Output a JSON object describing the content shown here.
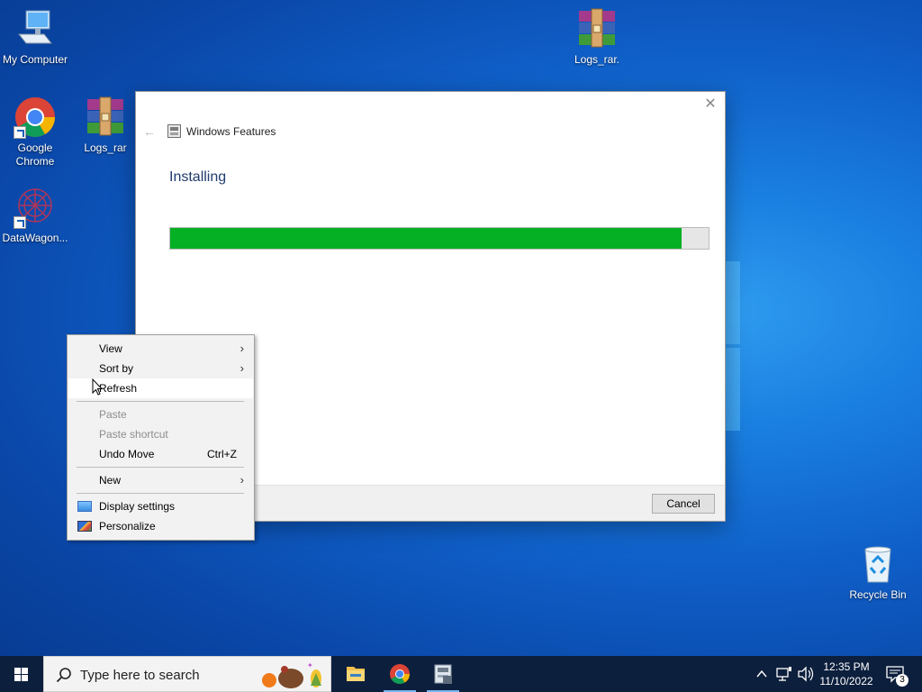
{
  "desktop": {
    "icons": [
      {
        "label": "My Computer",
        "icon": "computer-icon"
      },
      {
        "label": "Logs_rar.",
        "icon": "winrar-archive-icon"
      },
      {
        "label": "Google Chrome",
        "icon": "chrome-icon"
      },
      {
        "label": "Logs_rar",
        "icon": "winrar-archive-icon"
      },
      {
        "label": "DataWagon...",
        "icon": "datawagon-icon"
      },
      {
        "label": "Recycle Bin",
        "icon": "recycle-bin-icon"
      }
    ]
  },
  "dialog": {
    "title": "Windows Features",
    "heading": "Installing",
    "progress": 0.95,
    "progress_color": "#06b025",
    "cancel_label": "Cancel",
    "close_glyph": "✕",
    "back_glyph": "←"
  },
  "context_menu": {
    "view": "View",
    "sort_by": "Sort by",
    "refresh": "Refresh",
    "paste": "Paste",
    "paste_shortcut": "Paste shortcut",
    "undo_move": "Undo Move",
    "undo_move_accel": "Ctrl+Z",
    "new": "New",
    "display_settings": "Display settings",
    "personalize": "Personalize",
    "submenu_glyph": "›"
  },
  "taskbar": {
    "search_placeholder": "Type here to search",
    "apps": [
      {
        "name": "File Explorer",
        "icon": "file-explorer-icon"
      },
      {
        "name": "Google Chrome",
        "icon": "chrome-icon"
      },
      {
        "name": "Windows Features",
        "icon": "windows-features-icon"
      }
    ],
    "time": "12:35 PM",
    "date": "11/10/2022",
    "notification_count": "3",
    "accent": "#0c1f3d"
  }
}
